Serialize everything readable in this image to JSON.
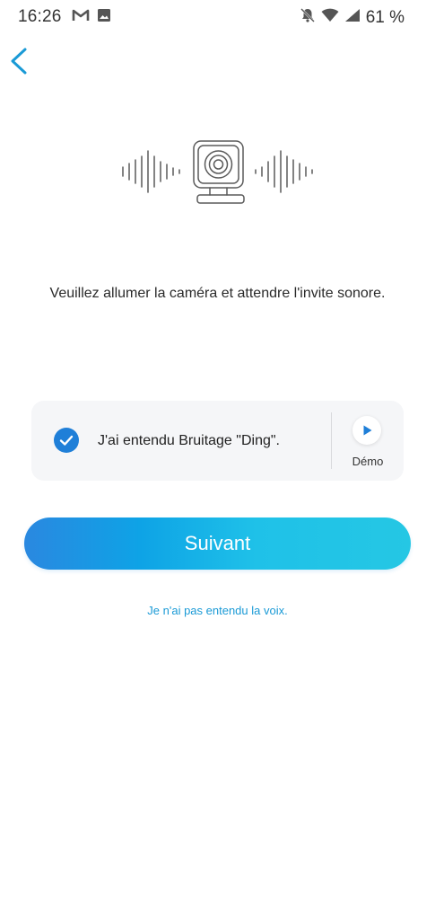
{
  "status_bar": {
    "time": "16:26",
    "battery": "61 %",
    "left_icons": [
      "gmail-icon",
      "image-icon"
    ],
    "right_icons": [
      "notifications-off-icon",
      "wifi-icon",
      "signal-icon"
    ]
  },
  "header": {
    "back_icon": "chevron-left-icon"
  },
  "illustration": {
    "icon": "camera-sound-icon"
  },
  "main": {
    "instruction": "Veuillez allumer la caméra et attendre l'invite sonore."
  },
  "check_card": {
    "checked": true,
    "label": "J'ai entendu Bruitage \"Ding\".",
    "demo_label": "Démo"
  },
  "actions": {
    "next_label": "Suivant",
    "not_heard_label": "Je n'ai pas entendu la voix."
  },
  "colors": {
    "accent": "#1a9ad6",
    "check": "#1f7fd8",
    "button_start": "#2a88e0",
    "button_end": "#25c7e4",
    "card_bg": "#f5f6f8"
  }
}
